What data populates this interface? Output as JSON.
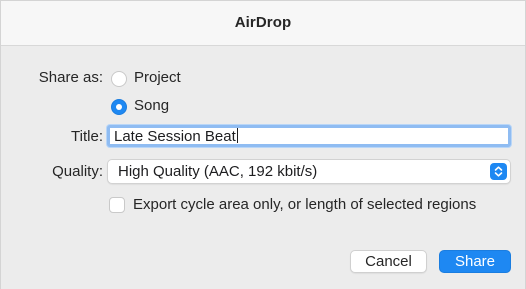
{
  "dialog": {
    "title": "AirDrop"
  },
  "share_as": {
    "label": "Share as:",
    "options": [
      {
        "label": "Project",
        "selected": false
      },
      {
        "label": "Song",
        "selected": true
      }
    ]
  },
  "title_field": {
    "label": "Title:",
    "value": "Late Session Beat"
  },
  "quality": {
    "label": "Quality:",
    "selected": "High Quality (AAC, 192 kbit/s)",
    "icon": "chevron-up-down-icon"
  },
  "export_option": {
    "label": "Export cycle area only, or length of selected regions",
    "checked": false
  },
  "buttons": {
    "cancel": "Cancel",
    "share": "Share"
  },
  "colors": {
    "accent": "#1e88f2",
    "background": "#ececec",
    "focus_ring": "#8fbcf2"
  }
}
